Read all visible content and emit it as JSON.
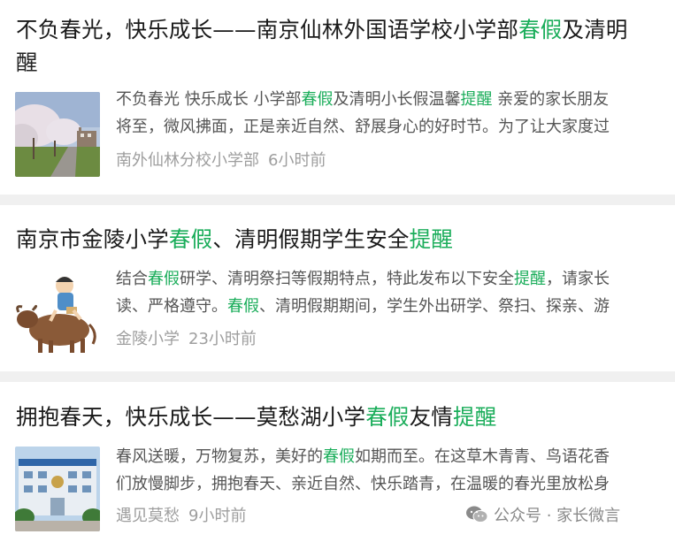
{
  "articles": [
    {
      "title_parts": [
        {
          "t": "不负春光，快乐成长——南京仙林外国语学校小学部",
          "hl": false
        },
        {
          "t": "春假",
          "hl": true
        },
        {
          "t": "及清明",
          "hl": false
        }
      ],
      "title_line2": [
        {
          "t": "醒",
          "hl": true
        }
      ],
      "snippet_line1": [
        {
          "t": "不负春光 快乐成长 小学部",
          "hl": false
        },
        {
          "t": "春假",
          "hl": true
        },
        {
          "t": "及清明小长假温馨",
          "hl": false
        },
        {
          "t": "提醒",
          "hl": true
        },
        {
          "t": " 亲爱的家长朋友",
          "hl": false
        }
      ],
      "snippet_line2": [
        {
          "t": "将至，微风拂面，正是亲近自然、舒展身心的好时节。为了让大家度过",
          "hl": false
        }
      ],
      "source": "南外仙林分校小学部",
      "time": "6小时前",
      "thumb": "campus-cherry-blossom-photo"
    },
    {
      "title_parts": [
        {
          "t": "南京市金陵小学",
          "hl": false
        },
        {
          "t": "春假",
          "hl": true
        },
        {
          "t": "、清明假期学生安全",
          "hl": false
        },
        {
          "t": "提醒",
          "hl": true
        }
      ],
      "snippet_line1": [
        {
          "t": "结合",
          "hl": false
        },
        {
          "t": "春假",
          "hl": true
        },
        {
          "t": "研学、清明祭扫等假期特点，特此发布以下安全",
          "hl": false
        },
        {
          "t": "提醒",
          "hl": true
        },
        {
          "t": "，请家长",
          "hl": false
        }
      ],
      "snippet_line2": [
        {
          "t": "读、严格遵守。",
          "hl": false
        },
        {
          "t": "春假",
          "hl": true
        },
        {
          "t": "、清明假期期间，学生外出研学、祭扫、探亲、游",
          "hl": false
        }
      ],
      "source": "金陵小学",
      "time": "23小时前",
      "thumb": "child-riding-ox-illustration"
    },
    {
      "title_parts": [
        {
          "t": "拥抱春天，快乐成长——莫愁湖小学",
          "hl": false
        },
        {
          "t": "春假",
          "hl": true
        },
        {
          "t": "友情",
          "hl": false
        },
        {
          "t": "提醒",
          "hl": true
        }
      ],
      "snippet_line1": [
        {
          "t": "春风送暖，万物复苏，美好的",
          "hl": false
        },
        {
          "t": "春假",
          "hl": true
        },
        {
          "t": "如期而至。在这草木青青、鸟语花香",
          "hl": false
        }
      ],
      "snippet_line2": [
        {
          "t": "们放慢脚步，拥抱春天、亲近自然、快乐踏青，在温暖的春光里放松身",
          "hl": false
        }
      ],
      "source": "遇见莫愁",
      "time": "9小时前",
      "thumb": "school-building-photo"
    }
  ],
  "watermark": {
    "text": "公众号 · 家长微言",
    "icon": "wechat-icon"
  },
  "colors": {
    "highlight": "#1aad5a",
    "separator": "#f0f0f0",
    "meta": "#9e9e9e"
  }
}
